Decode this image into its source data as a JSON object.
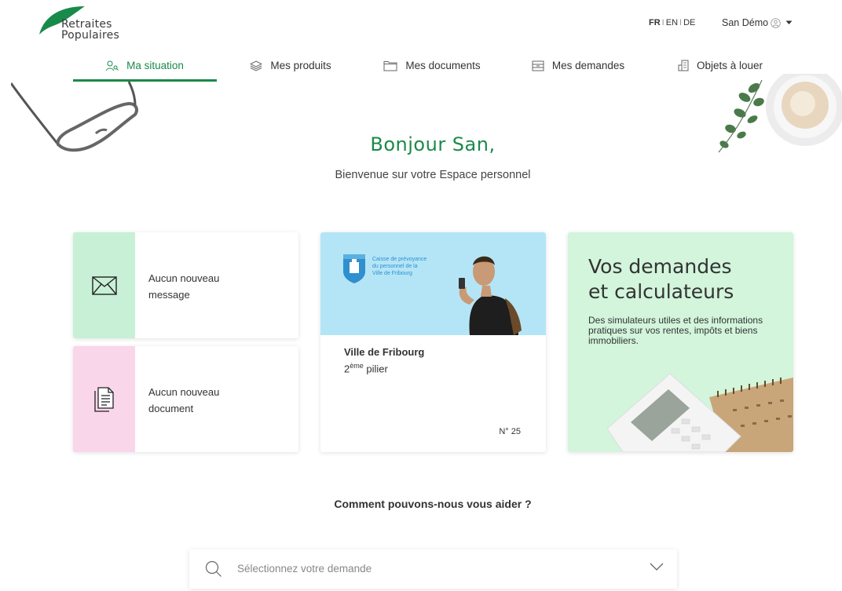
{
  "brand": {
    "line1": "Retraites",
    "line2": "Populaires",
    "color": "#1a8a4a"
  },
  "header": {
    "languages": [
      {
        "label": "FR",
        "active": true
      },
      {
        "label": "EN",
        "active": false
      },
      {
        "label": "DE",
        "active": false
      }
    ],
    "separator": "I",
    "user_name": "San Démo"
  },
  "nav": {
    "items": [
      {
        "label": "Ma situation",
        "icon": "user-search-icon",
        "active": true
      },
      {
        "label": "Mes produits",
        "icon": "layers-icon",
        "active": false
      },
      {
        "label": "Mes documents",
        "icon": "folder-icon",
        "active": false
      },
      {
        "label": "Mes demandes",
        "icon": "inbox-icon",
        "active": false
      },
      {
        "label": "Objets à louer",
        "icon": "building-icon",
        "active": false
      }
    ]
  },
  "hero": {
    "title": "Bonjour San,",
    "subtitle": "Bienvenue sur votre Espace personnel"
  },
  "cards": {
    "messages": {
      "line1": "Aucun nouveau",
      "line2": "message",
      "icon": "envelope-icon",
      "accent": "#c8f0d6"
    },
    "documents": {
      "line1": "Aucun nouveau",
      "line2": "document",
      "icon": "document-icon",
      "accent": "#f9d6ea"
    },
    "product": {
      "caisse_line1": "Caisse de prévoyance",
      "caisse_line2": "du personnel de la",
      "caisse_line3": "Ville de Fribourg",
      "title": "Ville de Fribourg",
      "ordinal": "2",
      "ordinal_sup": "ème",
      "pillar": " pilier",
      "number": "N° 25"
    },
    "calculators": {
      "title_line1": "Vos demandes",
      "title_line2": "et calculateurs",
      "description": "Des simulateurs utiles et des informations pratiques sur vos rentes, impôts et biens immobiliers.",
      "accent": "#d2f5dc"
    }
  },
  "help": {
    "title": "Comment pouvons-nous vous aider ?",
    "select_placeholder": "Sélectionnez votre demande"
  }
}
